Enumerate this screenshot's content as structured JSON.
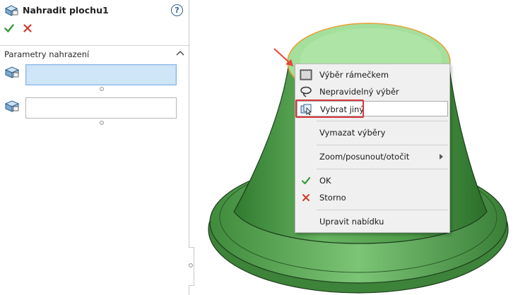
{
  "panel": {
    "title": "Nahradit plochu1",
    "help_glyph": "?",
    "section_title": "Parametry nahrazení",
    "feature_icon": "replace-face-icon",
    "target_faces_value": "",
    "replacement_faces_value": ""
  },
  "context_menu": {
    "items": [
      {
        "label": "Výběr rámečkem",
        "icon": "box-select-icon"
      },
      {
        "label": "Nepravidelný výběr",
        "icon": "lasso-select-icon"
      },
      {
        "label": "Vybrat jiný",
        "icon": "select-other-icon"
      },
      {
        "label": "Vymazat výběry",
        "icon": ""
      },
      {
        "label": "Zoom/posunout/otočit",
        "icon": "",
        "has_submenu": true
      },
      {
        "label": "OK",
        "icon": "ok-check-icon"
      },
      {
        "label": "Storno",
        "icon": "cancel-x-icon"
      },
      {
        "label": "Upravit nabídku",
        "icon": ""
      }
    ],
    "hovered_item": "Vybrat jiný"
  },
  "colors": {
    "ok_green": "#3a9a3a",
    "cancel_red": "#d03a2a",
    "highlight_red": "#d9363e",
    "model_green": "#5fae5a",
    "selected_face": "#a8e0a0",
    "selection_outline": "#e8a23c"
  }
}
